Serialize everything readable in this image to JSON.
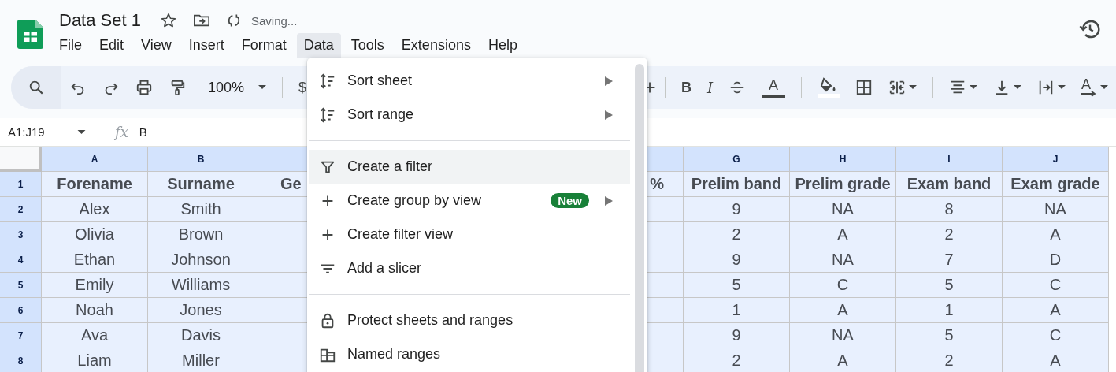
{
  "document": {
    "title": "Data Set 1",
    "status": "Saving..."
  },
  "menus": [
    {
      "label": "File",
      "selected": false
    },
    {
      "label": "Edit",
      "selected": false
    },
    {
      "label": "View",
      "selected": false
    },
    {
      "label": "Insert",
      "selected": false
    },
    {
      "label": "Format",
      "selected": false
    },
    {
      "label": "Data",
      "selected": true
    },
    {
      "label": "Tools",
      "selected": false
    },
    {
      "label": "Extensions",
      "selected": false
    },
    {
      "label": "Help",
      "selected": false
    }
  ],
  "toolbar": {
    "zoom": "100%",
    "currency": "$",
    "bold": "B",
    "italic": "I",
    "text_color": "A",
    "rotate": "A"
  },
  "formula_bar": {
    "name_box": "A1:J19",
    "function_label": "fx",
    "content": "B"
  },
  "columns": [
    {
      "letter": "A",
      "kind": "full"
    },
    {
      "letter": "B",
      "kind": "full"
    },
    {
      "kind": "cut"
    },
    {
      "kind": "cut"
    },
    {
      "letter": "G",
      "kind": "full"
    },
    {
      "letter": "H",
      "kind": "full"
    },
    {
      "letter": "I",
      "kind": "full"
    },
    {
      "letter": "J",
      "kind": "full"
    }
  ],
  "header_row": {
    "number": "1",
    "cells": [
      "Forename",
      "Surname",
      "Ge",
      "%",
      "Prelim band",
      "Prelim grade",
      "Exam band",
      "Exam grade"
    ]
  },
  "rows": [
    {
      "number": "2",
      "cells": [
        "Alex",
        "Smith",
        "9",
        "NA",
        "8",
        "NA"
      ]
    },
    {
      "number": "3",
      "cells": [
        "Olivia",
        "Brown",
        "2",
        "A",
        "2",
        "A"
      ]
    },
    {
      "number": "4",
      "cells": [
        "Ethan",
        "Johnson",
        "9",
        "NA",
        "7",
        "D"
      ]
    },
    {
      "number": "5",
      "cells": [
        "Emily",
        "Williams",
        "5",
        "C",
        "5",
        "C"
      ]
    },
    {
      "number": "6",
      "cells": [
        "Noah",
        "Jones",
        "1",
        "A",
        "1",
        "A"
      ]
    },
    {
      "number": "7",
      "cells": [
        "Ava",
        "Davis",
        "9",
        "NA",
        "5",
        "C"
      ]
    },
    {
      "number": "8",
      "cells": [
        "Liam",
        "Miller",
        "2",
        "A",
        "2",
        "A"
      ]
    }
  ],
  "data_menu": {
    "sections": [
      {
        "items": [
          {
            "label": "Sort sheet",
            "submenu": true,
            "highlighted": false
          },
          {
            "label": "Sort range",
            "submenu": true,
            "highlighted": false
          }
        ]
      },
      {
        "items": [
          {
            "label": "Create a filter",
            "submenu": false,
            "highlighted": true
          },
          {
            "label": "Create group by view",
            "submenu": true,
            "highlighted": false,
            "badge": "New"
          },
          {
            "label": "Create filter view",
            "submenu": false,
            "highlighted": false
          },
          {
            "label": "Add a slicer",
            "submenu": false,
            "highlighted": false
          }
        ]
      },
      {
        "items": [
          {
            "label": "Protect sheets and ranges",
            "submenu": false,
            "highlighted": false
          },
          {
            "label": "Named ranges",
            "submenu": false,
            "highlighted": false
          }
        ]
      }
    ]
  }
}
